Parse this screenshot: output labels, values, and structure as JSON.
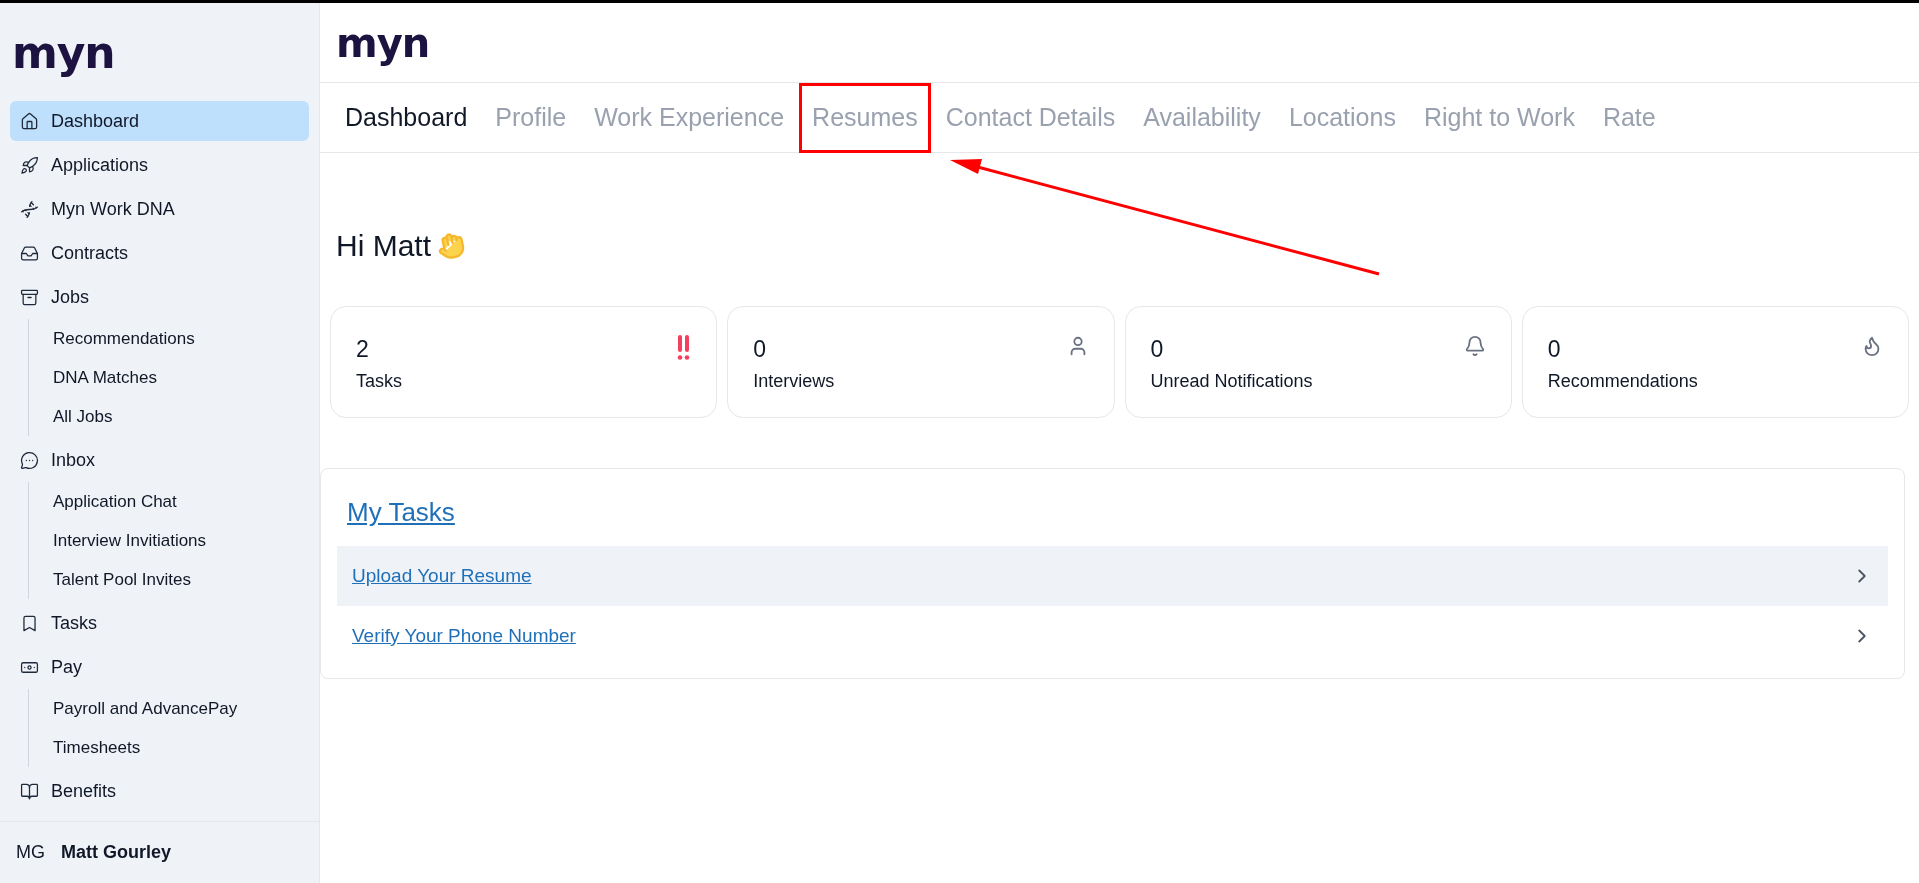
{
  "sidebar": {
    "logo": "myn",
    "items": [
      {
        "label": "Dashboard",
        "selected": true
      },
      {
        "label": "Applications",
        "selected": false
      },
      {
        "label": "Myn Work DNA",
        "selected": false
      },
      {
        "label": "Contracts",
        "selected": false
      },
      {
        "label": "Jobs",
        "selected": false,
        "children": [
          {
            "label": "Recommendations"
          },
          {
            "label": "DNA Matches"
          },
          {
            "label": "All Jobs"
          }
        ]
      },
      {
        "label": "Inbox",
        "selected": false,
        "children": [
          {
            "label": "Application Chat"
          },
          {
            "label": "Interview Invitiations"
          },
          {
            "label": "Talent Pool Invites"
          }
        ]
      },
      {
        "label": "Tasks",
        "selected": false
      },
      {
        "label": "Pay",
        "selected": false,
        "children": [
          {
            "label": "Payroll and AdvancePay"
          },
          {
            "label": "Timesheets"
          }
        ]
      },
      {
        "label": "Benefits",
        "selected": false
      }
    ],
    "user": {
      "initials": "MG",
      "name": "Matt Gourley"
    }
  },
  "header": {
    "logo": "myn"
  },
  "tabs": [
    {
      "label": "Dashboard",
      "selected": true,
      "highlighted": false
    },
    {
      "label": "Profile",
      "selected": false,
      "highlighted": false
    },
    {
      "label": "Work Experience",
      "selected": false,
      "highlighted": false
    },
    {
      "label": "Resumes",
      "selected": false,
      "highlighted": true
    },
    {
      "label": "Contact Details",
      "selected": false,
      "highlighted": false
    },
    {
      "label": "Availability",
      "selected": false,
      "highlighted": false
    },
    {
      "label": "Locations",
      "selected": false,
      "highlighted": false
    },
    {
      "label": "Right to Work",
      "selected": false,
      "highlighted": false
    },
    {
      "label": "Rate",
      "selected": false,
      "highlighted": false
    }
  ],
  "greeting": "Hi Matt",
  "stats": [
    {
      "value": "2",
      "label": "Tasks"
    },
    {
      "value": "0",
      "label": "Interviews"
    },
    {
      "value": "0",
      "label": "Unread Notifications"
    },
    {
      "value": "0",
      "label": "Recommendations"
    }
  ],
  "tasks": {
    "title": "My Tasks",
    "items": [
      {
        "label": "Upload Your Resume",
        "selected": true
      },
      {
        "label": "Verify Your Phone Number",
        "selected": false
      }
    ]
  }
}
